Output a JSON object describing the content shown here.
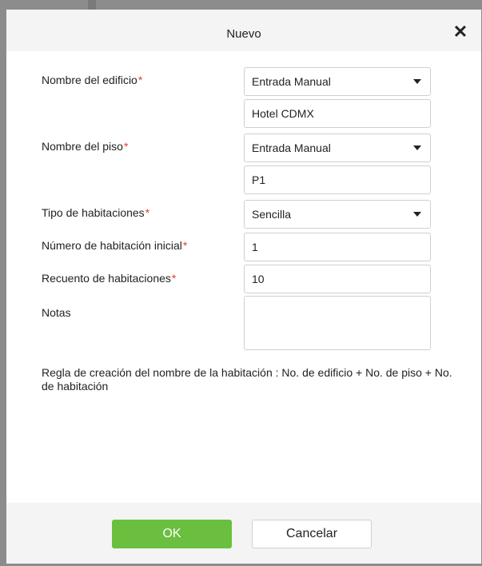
{
  "dialog": {
    "title": "Nuevo",
    "close_glyph": "✕"
  },
  "form": {
    "building_name": {
      "label": "Nombre del edificio",
      "required_mark": "*",
      "mode_value": "Entrada Manual",
      "text_value": "Hotel CDMX"
    },
    "floor_name": {
      "label": "Nombre del piso",
      "required_mark": "*",
      "mode_value": "Entrada Manual",
      "text_value": "P1"
    },
    "room_type": {
      "label": "Tipo de habitaciones",
      "required_mark": "*",
      "value": "Sencilla"
    },
    "start_room_number": {
      "label": "Número de habitación inicial",
      "required_mark": "*",
      "value": "1"
    },
    "room_count": {
      "label": "Recuento de habitaciones",
      "required_mark": "*",
      "value": "10"
    },
    "notes": {
      "label": "Notas",
      "value": ""
    }
  },
  "rule_text": "Regla de creación del nombre de la habitación : No. de edificio + No. de piso + No. de habitación",
  "footer": {
    "ok_label": "OK",
    "cancel_label": "Cancelar"
  },
  "colors": {
    "required": "#e53935",
    "ok_button": "#6abf3e",
    "header_bg": "#f4f4f4",
    "backdrop": "#8c8c8c"
  },
  "icons": {
    "close": "close-icon",
    "dropdown": "caret-down-icon"
  }
}
